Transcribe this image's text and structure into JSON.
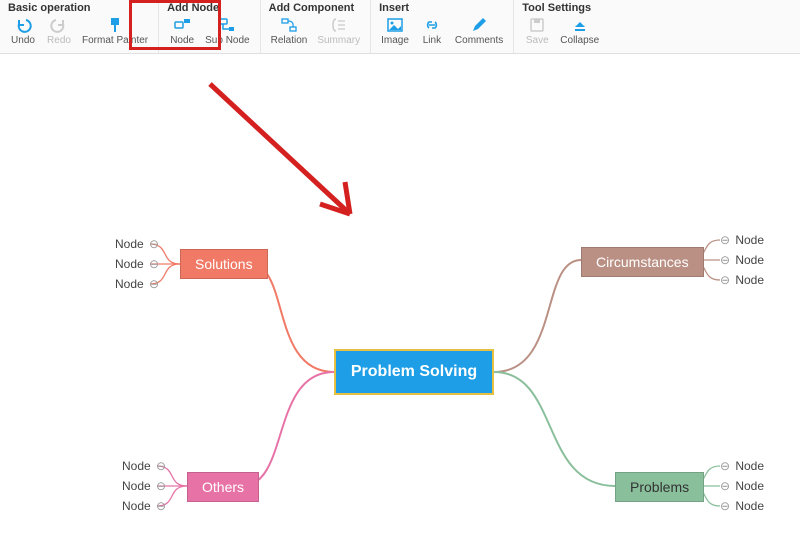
{
  "toolbar": {
    "groups": [
      {
        "title": "Basic operation",
        "items": [
          {
            "id": "undo",
            "label": "Undo",
            "icon": "undo",
            "color": "#1d9ee6",
            "interact": true
          },
          {
            "id": "redo",
            "label": "Redo",
            "icon": "redo",
            "color": "#bbb",
            "interact": true
          },
          {
            "id": "format-painter",
            "label": "Format Painter",
            "icon": "brush",
            "color": "#1d9ee6",
            "interact": true
          }
        ]
      },
      {
        "title": "Add Node",
        "items": [
          {
            "id": "node",
            "label": "Node",
            "icon": "add-node",
            "color": "#1d9ee6",
            "interact": true
          },
          {
            "id": "sub-node",
            "label": "Sub Node",
            "icon": "sub-node",
            "color": "#1d9ee6",
            "interact": true
          }
        ]
      },
      {
        "title": "Add Component",
        "items": [
          {
            "id": "relation",
            "label": "Relation",
            "icon": "relation",
            "color": "#1d9ee6",
            "interact": true
          },
          {
            "id": "summary",
            "label": "Summary",
            "icon": "summary",
            "color": "#ccc",
            "interact": false
          }
        ]
      },
      {
        "title": "Insert",
        "items": [
          {
            "id": "image",
            "label": "Image",
            "icon": "image",
            "color": "#1d9ee6",
            "interact": true
          },
          {
            "id": "link",
            "label": "Link",
            "icon": "link",
            "color": "#1d9ee6",
            "interact": true
          },
          {
            "id": "comments",
            "label": "Comments",
            "icon": "pencil",
            "color": "#1d9ee6",
            "interact": true
          }
        ]
      },
      {
        "title": "Tool Settings",
        "items": [
          {
            "id": "save",
            "label": "Save",
            "icon": "save",
            "color": "#ccc",
            "interact": false
          },
          {
            "id": "collapse",
            "label": "Collapse",
            "icon": "collapse",
            "color": "#1d9ee6",
            "interact": true
          }
        ]
      }
    ]
  },
  "mindmap": {
    "central": "Problem Solving",
    "branches": {
      "solutions": {
        "label": "Solutions",
        "color": "#f07a66",
        "leaves": [
          "Node",
          "Node",
          "Node"
        ]
      },
      "circumstances": {
        "label": "Circumstances",
        "color": "#bb9084",
        "leaves": [
          "Node",
          "Node",
          "Node"
        ]
      },
      "others": {
        "label": "Others",
        "color": "#e773a6",
        "leaves": [
          "Node",
          "Node",
          "Node"
        ]
      },
      "problems": {
        "label": "Problems",
        "color": "#8abf9c",
        "leaves": [
          "Node",
          "Node",
          "Node"
        ]
      }
    }
  },
  "annotation": {
    "highlight_group": "Add Node"
  }
}
